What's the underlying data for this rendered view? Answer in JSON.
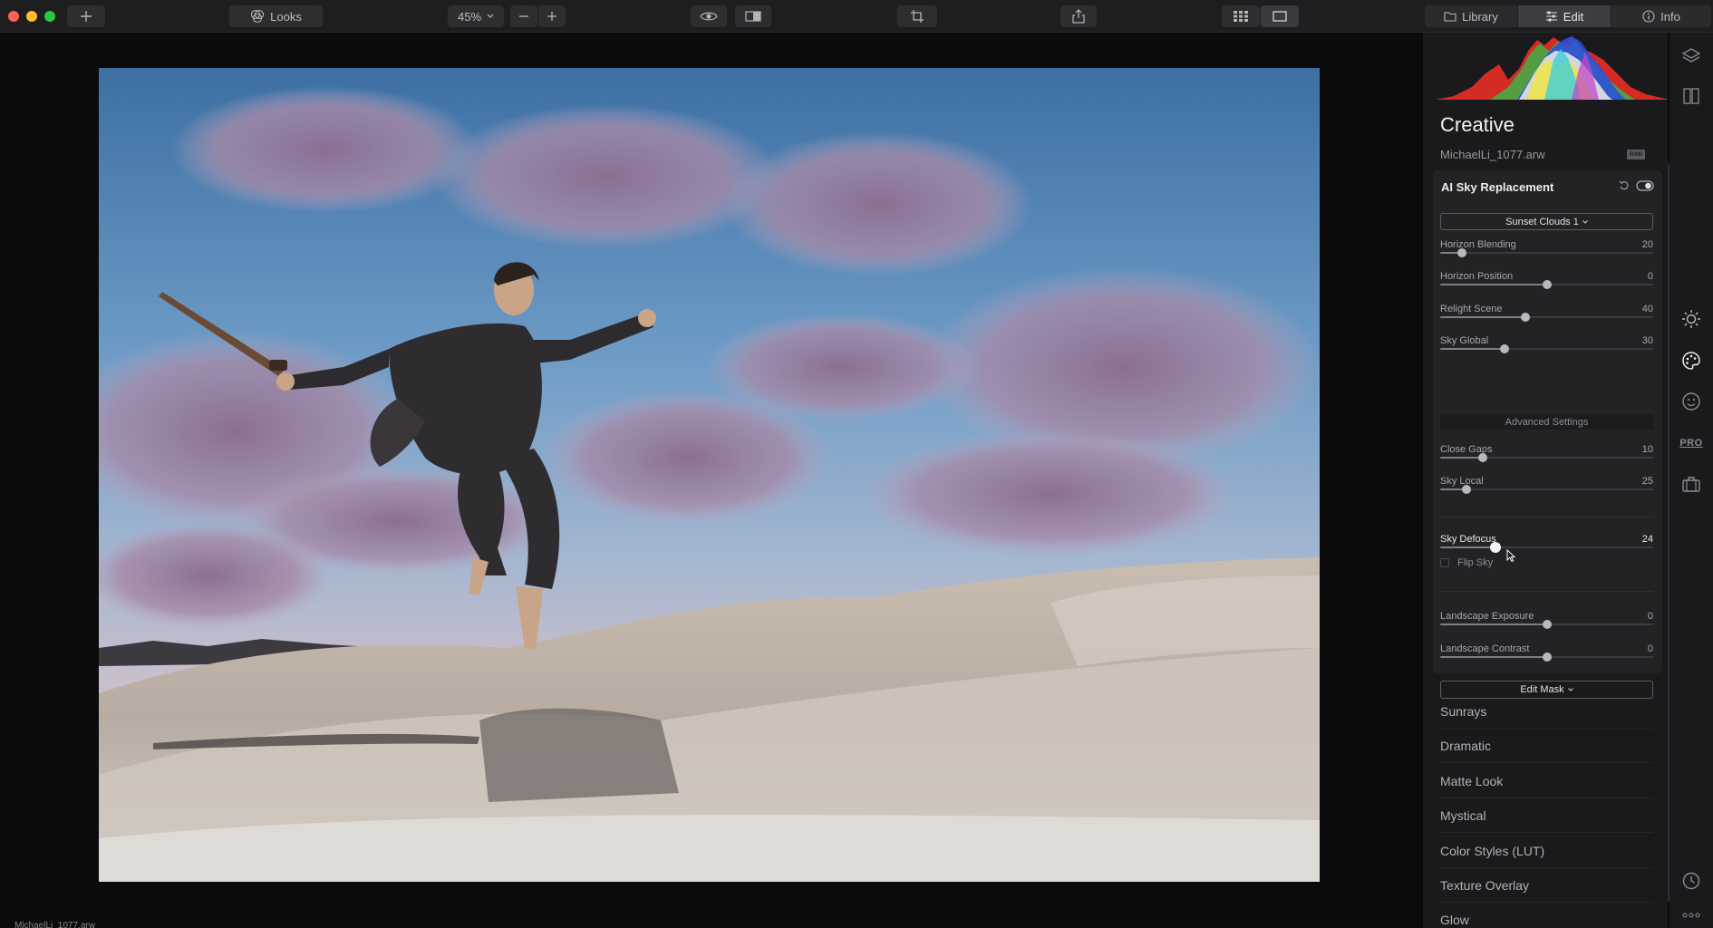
{
  "toolbar": {
    "looks_label": "Looks",
    "zoom_label": "45%",
    "tabs": [
      {
        "label": "Library",
        "icon": "library-icon",
        "active": false
      },
      {
        "label": "Edit",
        "icon": "sliders-icon",
        "active": true
      },
      {
        "label": "Info",
        "icon": "info-icon",
        "active": false
      }
    ]
  },
  "panel": {
    "title": "Creative",
    "file_name": "MichaelLi_1077.arw",
    "raw_badge": "RAW",
    "sky": {
      "title": "AI Sky Replacement",
      "sky_preset": "Sunset Clouds 1",
      "advanced_label": "Advanced Settings",
      "flip_label": "Flip Sky",
      "flip_checked": false,
      "edit_mask_label": "Edit Mask",
      "sliders": [
        {
          "label": "Horizon Blending",
          "value": "20",
          "pos": 0.1
        },
        {
          "label": "Horizon Position",
          "value": "0",
          "pos": 0.5
        },
        {
          "label": "Relight Scene",
          "value": "40",
          "pos": 0.4
        },
        {
          "label": "Sky Global",
          "value": "30",
          "pos": 0.3
        },
        {
          "label": "Close Gaps",
          "value": "10",
          "pos": 0.2
        },
        {
          "label": "Sky Local",
          "value": "25",
          "pos": 0.125
        },
        {
          "label": "Sky Defocus",
          "value": "24",
          "pos": 0.26
        },
        {
          "label": "Landscape Exposure",
          "value": "0",
          "pos": 0.5
        },
        {
          "label": "Landscape Contrast",
          "value": "0",
          "pos": 0.5
        }
      ]
    },
    "tools": [
      "Sunrays",
      "Dramatic",
      "Matte Look",
      "Mystical",
      "Color Styles (LUT)",
      "Texture Overlay",
      "Glow"
    ]
  },
  "canvas": {
    "footer_filename": "MichaelLi_1077.arw"
  },
  "colors": {
    "accent": "#f2f2f4",
    "panel_bg": "#1a1a1c",
    "card_bg": "#232326"
  }
}
